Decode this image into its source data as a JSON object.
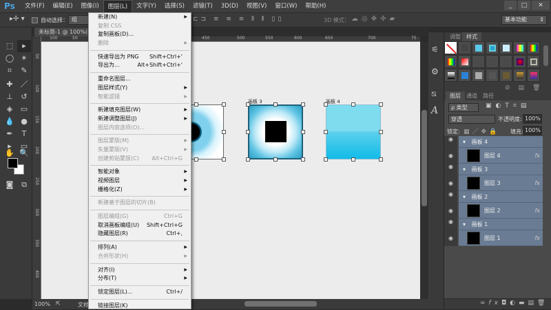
{
  "app": {
    "logo": "Ps"
  },
  "menubar": {
    "items": [
      "文件(F)",
      "编辑(E)",
      "图像(I)",
      "图层(L)",
      "文字(Y)",
      "选择(S)",
      "滤镜(T)",
      "3D(D)",
      "视图(V)",
      "窗口(W)",
      "帮助(H)"
    ],
    "active": "图层(L)"
  },
  "window_controls": {
    "minimize": "_",
    "maximize": "□",
    "close": "✕"
  },
  "options": {
    "auto_select_label": "自动选择：",
    "auto_select_value": "组",
    "mode3d_label": "3D 模式：",
    "workspace": "基本功能"
  },
  "document": {
    "tab_title": "未标题-1 @ 100%(RG",
    "zoom": "100%",
    "doc_label": "文档"
  },
  "ruler": {
    "h": [
      "100",
      "50",
      "450",
      "500",
      "550",
      "600",
      "650",
      "700",
      "75"
    ],
    "v": [
      "50",
      "100",
      "150",
      "200",
      "250",
      "300",
      "350",
      "400"
    ]
  },
  "artboards": [
    {
      "label": "画板 3"
    },
    {
      "label": "画板 4"
    }
  ],
  "layer_menu": {
    "groups": [
      [
        {
          "label": "新建(N)",
          "submenu": true
        },
        {
          "label": "复制 CSS",
          "disabled": true
        },
        {
          "label": "复制画板(D)..."
        },
        {
          "label": "删除",
          "disabled": true,
          "submenu": true
        }
      ],
      [
        {
          "label": "快速导出为 PNG",
          "shortcut": "Shift+Ctrl+'"
        },
        {
          "label": "导出为...",
          "shortcut": "Alt+Shift+Ctrl+'"
        }
      ],
      [
        {
          "label": "重命名图层..."
        },
        {
          "label": "图层样式(Y)",
          "submenu": true
        },
        {
          "label": "智能滤镜",
          "disabled": true,
          "submenu": true
        }
      ],
      [
        {
          "label": "新建填充图层(W)",
          "submenu": true
        },
        {
          "label": "新建调整图层(J)",
          "submenu": true
        },
        {
          "label": "图层内容选项(O)...",
          "disabled": true
        }
      ],
      [
        {
          "label": "图层蒙版(M)",
          "disabled": true,
          "submenu": true
        },
        {
          "label": "矢量蒙版(V)",
          "disabled": true,
          "submenu": true
        },
        {
          "label": "创建剪贴蒙版(C)",
          "disabled": true,
          "shortcut": "Alt+Ctrl+G"
        }
      ],
      [
        {
          "label": "智能对象",
          "submenu": true
        },
        {
          "label": "视频图层",
          "submenu": true
        },
        {
          "label": "栅格化(Z)",
          "submenu": true
        }
      ],
      [
        {
          "label": "新建基于图层的切片(B)",
          "disabled": true
        }
      ],
      [
        {
          "label": "图层编组(G)",
          "disabled": true,
          "shortcut": "Ctrl+G"
        },
        {
          "label": "取消画板编组(U)",
          "shortcut": "Shift+Ctrl+G"
        },
        {
          "label": "隐藏图层(R)",
          "shortcut": "Ctrl+,"
        }
      ],
      [
        {
          "label": "排列(A)",
          "submenu": true
        },
        {
          "label": "合并形状(H)",
          "disabled": true,
          "submenu": true
        }
      ],
      [
        {
          "label": "对齐(I)",
          "submenu": true
        },
        {
          "label": "分布(T)",
          "submenu": true
        }
      ],
      [
        {
          "label": "锁定图层(L)...",
          "shortcut": "Ctrl+/"
        }
      ],
      [
        {
          "label": "链接图层(K)"
        }
      ]
    ]
  },
  "styles_panel": {
    "tabs": [
      "调整",
      "样式"
    ],
    "active": "样式"
  },
  "layers_panel": {
    "tabs": [
      "图层",
      "通道",
      "路径"
    ],
    "active": "图层",
    "filter": "ρ 类型",
    "blend_mode": "穿透",
    "opacity_label": "不透明度:",
    "opacity": "100%",
    "lock_label": "锁定:",
    "fill_label": "填充:",
    "fill": "100%",
    "items": [
      {
        "group": "画板 4",
        "layer": "图层 4"
      },
      {
        "group": "画板 3",
        "layer": "图层 3"
      },
      {
        "group": "画板 2",
        "layer": "图层 2"
      },
      {
        "group": "画板 1",
        "layer": "图层 1"
      }
    ],
    "fx": "fx",
    "footer_icons": [
      "link-icon",
      "fx-icon",
      "mask-icon",
      "adjustment-icon",
      "folder-icon",
      "new-layer-icon",
      "trash-icon"
    ]
  },
  "colors": {
    "accent": "#4aa3df",
    "layer_selected": "#6a7c93",
    "artboard_cyan": "#1bbde8"
  }
}
